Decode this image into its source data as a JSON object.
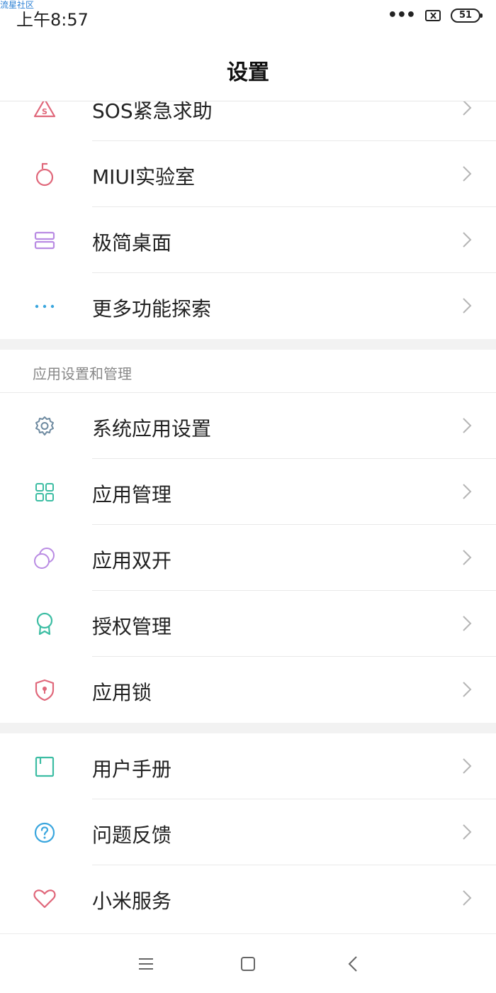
{
  "watermark": "流星社区",
  "status_bar": {
    "time": "上午8:57",
    "battery": "51",
    "icons": [
      "more-dots-icon",
      "no-sim-icon",
      "battery-icon"
    ]
  },
  "header": {
    "title": "设置"
  },
  "group_top": {
    "items": [
      {
        "label": "SOS紧急求助",
        "icon": "sos-icon",
        "color": "#e0677a"
      },
      {
        "label": "MIUI实验室",
        "icon": "flask-icon",
        "color": "#e0677a"
      },
      {
        "label": "极简桌面",
        "icon": "stacked-layout-icon",
        "color": "#b98be3"
      },
      {
        "label": "更多功能探索",
        "icon": "more-horizontal-icon",
        "color": "#3aa6de"
      }
    ]
  },
  "section_apps": {
    "header": "应用设置和管理",
    "items": [
      {
        "label": "系统应用设置",
        "icon": "gear-icon",
        "color": "#6e8aa0"
      },
      {
        "label": "应用管理",
        "icon": "grid-icon",
        "color": "#3cbda3"
      },
      {
        "label": "应用双开",
        "icon": "dual-circles-icon",
        "color": "#b98be3"
      },
      {
        "label": "授权管理",
        "icon": "award-badge-icon",
        "color": "#3cbda3"
      },
      {
        "label": "应用锁",
        "icon": "shield-lock-icon",
        "color": "#e0677a"
      }
    ]
  },
  "group_bottom": {
    "items": [
      {
        "label": "用户手册",
        "icon": "book-icon",
        "color": "#3cbda3"
      },
      {
        "label": "问题反馈",
        "icon": "question-icon",
        "color": "#3aa6de"
      },
      {
        "label": "小米服务",
        "icon": "heart-icon",
        "color": "#e0677a"
      }
    ]
  },
  "nav_bar": {
    "icons": [
      "menu-icon",
      "home-square-icon",
      "back-chevron-icon"
    ]
  },
  "chevron_color": "#b5b5b5"
}
